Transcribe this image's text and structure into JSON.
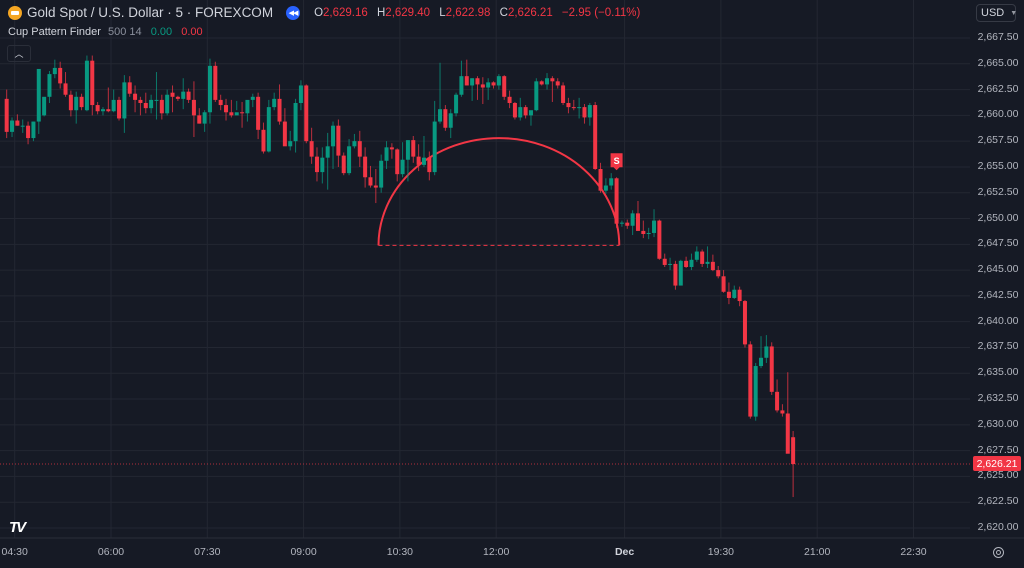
{
  "header": {
    "symbol_title": "Gold Spot / U.S. Dollar · 5 · FOREXCOM",
    "ohlc": [
      {
        "key": "O",
        "value": "2,629.16"
      },
      {
        "key": "H",
        "value": "2,629.40"
      },
      {
        "key": "L",
        "value": "2,622.98"
      },
      {
        "key": "C",
        "value": "2,626.21"
      }
    ],
    "change": "−2.95 (−0.11%)"
  },
  "indicator": {
    "name": "Cup Pattern Finder",
    "params": "500 14",
    "value1": "0.00",
    "value2": "0.00"
  },
  "currency_selector": "USD",
  "current_price_label": "2,626.21",
  "colors": {
    "up": "#089981",
    "down": "#f23645",
    "background": "#161a25",
    "grid": "#232732",
    "pattern": "#f23645"
  },
  "chart_data": {
    "type": "candlestick",
    "title": "Gold Spot / U.S. Dollar · 5 · FOREXCOM",
    "timeframe": "5",
    "y_ticks": [
      "2,667.50",
      "2,665.00",
      "2,662.50",
      "2,660.00",
      "2,657.50",
      "2,655.00",
      "2,652.50",
      "2,650.00",
      "2,647.50",
      "2,645.00",
      "2,642.50",
      "2,640.00",
      "2,637.50",
      "2,635.00",
      "2,632.50",
      "2,630.00",
      "2,627.50",
      "2,625.00",
      "2,622.50",
      "2,620.00"
    ],
    "ylim": [
      2618.8,
      2669.5
    ],
    "x_ticks": [
      {
        "label": "04:30",
        "bar": 2
      },
      {
        "label": "06:00",
        "bar": 20
      },
      {
        "label": "07:30",
        "bar": 38
      },
      {
        "label": "09:00",
        "bar": 56
      },
      {
        "label": "10:30",
        "bar": 74
      },
      {
        "label": "12:00",
        "bar": 92
      },
      {
        "label": "Dec",
        "bar": 116,
        "bold": true
      },
      {
        "label": "19:30",
        "bar": 134
      },
      {
        "label": "21:00",
        "bar": 152
      },
      {
        "label": "22:30",
        "bar": 170
      }
    ],
    "bar_count_visible": 186,
    "candles": [
      [
        2661.6,
        2662.5,
        2657.8,
        2658.4
      ],
      [
        2658.4,
        2659.8,
        2657.9,
        2659.5
      ],
      [
        2659.5,
        2660.1,
        2659.0,
        2659.0
      ],
      [
        2659.0,
        2659.6,
        2658.3,
        2659.0
      ],
      [
        2659.0,
        2659.4,
        2657.2,
        2657.8
      ],
      [
        2657.8,
        2659.4,
        2657.5,
        2659.4
      ],
      [
        2659.4,
        2660.6,
        2658.2,
        2664.5
      ],
      [
        2660.0,
        2660.6,
        2659.9,
        2661.8
      ],
      [
        2661.8,
        2664.3,
        2661.2,
        2664.0
      ],
      [
        2664.0,
        2665.4,
        2663.6,
        2664.6
      ],
      [
        2664.6,
        2665.2,
        2662.6,
        2663.1
      ],
      [
        2663.1,
        2664.2,
        2661.8,
        2662.0
      ],
      [
        2662.0,
        2662.4,
        2659.9,
        2660.5
      ],
      [
        2660.5,
        2662.3,
        2659.2,
        2661.8
      ],
      [
        2661.8,
        2662.1,
        2660.5,
        2660.8
      ],
      [
        2660.5,
        2665.8,
        2660.4,
        2665.3
      ],
      [
        2665.3,
        2665.8,
        2660.0,
        2661.0
      ],
      [
        2661.0,
        2661.3,
        2660.1,
        2660.4
      ],
      [
        2660.4,
        2660.8,
        2660.0,
        2660.6
      ],
      [
        2660.6,
        2662.7,
        2660.3,
        2660.4
      ],
      [
        2660.4,
        2662.5,
        2660.3,
        2661.5
      ],
      [
        2661.5,
        2661.8,
        2659.5,
        2659.7
      ],
      [
        2659.7,
        2663.9,
        2658.3,
        2663.2
      ],
      [
        2663.2,
        2663.8,
        2661.8,
        2662.1
      ],
      [
        2662.1,
        2662.9,
        2660.3,
        2661.5
      ],
      [
        2661.5,
        2661.8,
        2660.0,
        2661.2
      ],
      [
        2661.2,
        2662.2,
        2660.2,
        2660.7
      ],
      [
        2660.7,
        2662.0,
        2660.2,
        2661.5
      ],
      [
        2661.5,
        2664.2,
        2659.6,
        2661.5
      ],
      [
        2661.5,
        2662.0,
        2659.6,
        2660.2
      ],
      [
        2660.2,
        2662.5,
        2660.0,
        2662.0
      ],
      [
        2662.2,
        2662.9,
        2660.3,
        2661.8
      ],
      [
        2661.8,
        2661.9,
        2661.4,
        2661.6
      ],
      [
        2661.6,
        2663.6,
        2660.6,
        2662.3
      ],
      [
        2662.3,
        2662.6,
        2661.2,
        2661.5
      ],
      [
        2661.5,
        2663.3,
        2657.9,
        2660.0
      ],
      [
        2660.0,
        2660.7,
        2659.2,
        2659.2
      ],
      [
        2659.2,
        2660.5,
        2658.4,
        2660.3
      ],
      [
        2660.3,
        2665.5,
        2659.2,
        2664.8
      ],
      [
        2664.8,
        2665.2,
        2661.3,
        2661.5
      ],
      [
        2661.5,
        2662.0,
        2660.5,
        2661.0
      ],
      [
        2661.0,
        2661.6,
        2659.5,
        2660.3
      ],
      [
        2660.3,
        2661.5,
        2659.8,
        2660.0
      ],
      [
        2660.0,
        2661.4,
        2660.5,
        2660.3
      ],
      [
        2660.3,
        2661.3,
        2658.8,
        2660.2
      ],
      [
        2660.2,
        2661.0,
        2659.4,
        2661.5
      ],
      [
        2661.5,
        2662.1,
        2660.8,
        2661.8
      ],
      [
        2661.8,
        2662.2,
        2657.7,
        2658.6
      ],
      [
        2658.6,
        2659.3,
        2656.3,
        2656.5
      ],
      [
        2656.5,
        2661.5,
        2656.4,
        2660.8
      ],
      [
        2660.8,
        2662.2,
        2660.5,
        2661.6
      ],
      [
        2661.6,
        2663.0,
        2659.1,
        2659.4
      ],
      [
        2659.4,
        2660.7,
        2658.8,
        2657.0
      ],
      [
        2657.0,
        2658.5,
        2656.6,
        2657.5
      ],
      [
        2657.5,
        2661.6,
        2656.4,
        2661.2
      ],
      [
        2661.2,
        2663.4,
        2660.5,
        2662.9
      ],
      [
        2662.9,
        2663.0,
        2657.3,
        2657.5
      ],
      [
        2657.5,
        2658.8,
        2655.3,
        2656.0
      ],
      [
        2656.0,
        2656.9,
        2653.6,
        2654.5
      ],
      [
        2654.5,
        2656.9,
        2653.4,
        2655.9
      ],
      [
        2655.9,
        2658.3,
        2652.8,
        2657.0
      ],
      [
        2657.0,
        2659.4,
        2654.8,
        2659.0
      ],
      [
        2659.0,
        2659.6,
        2655.0,
        2656.1
      ],
      [
        2656.1,
        2656.4,
        2654.2,
        2654.4
      ],
      [
        2654.4,
        2657.7,
        2654.2,
        2657.0
      ],
      [
        2657.0,
        2658.2,
        2656.8,
        2657.5
      ],
      [
        2657.5,
        2658.5,
        2655.0,
        2656.0
      ],
      [
        2656.0,
        2656.9,
        2653.0,
        2654.0
      ],
      [
        2654.0,
        2655.1,
        2653.0,
        2653.2
      ],
      [
        2653.2,
        2654.8,
        2651.5,
        2653.0
      ],
      [
        2653.0,
        2656.2,
        2652.5,
        2655.6
      ],
      [
        2655.6,
        2657.5,
        2654.8,
        2656.9
      ],
      [
        2656.9,
        2657.3,
        2655.8,
        2656.7
      ],
      [
        2656.7,
        2656.8,
        2653.6,
        2654.3
      ],
      [
        2654.3,
        2657.4,
        2654.0,
        2655.7
      ],
      [
        2655.7,
        2657.6,
        2653.6,
        2657.6
      ],
      [
        2657.6,
        2658.0,
        2655.4,
        2656.0
      ],
      [
        2656.0,
        2657.2,
        2654.6,
        2655.2
      ],
      [
        2655.2,
        2658.0,
        2655.0,
        2655.9
      ],
      [
        2655.9,
        2656.5,
        2653.7,
        2654.5
      ],
      [
        2654.5,
        2661.4,
        2654.2,
        2659.4
      ],
      [
        2659.4,
        2665.1,
        2659.2,
        2660.6
      ],
      [
        2660.6,
        2661.0,
        2658.5,
        2658.8
      ],
      [
        2658.8,
        2660.6,
        2657.8,
        2660.2
      ],
      [
        2660.2,
        2662.2,
        2659.9,
        2662.0
      ],
      [
        2662.0,
        2665.3,
        2661.8,
        2663.8
      ],
      [
        2663.8,
        2665.4,
        2662.9,
        2662.9
      ],
      [
        2662.9,
        2663.6,
        2661.4,
        2663.6
      ],
      [
        2663.6,
        2663.8,
        2661.5,
        2663.0
      ],
      [
        2663.0,
        2663.7,
        2661.1,
        2662.7
      ],
      [
        2662.7,
        2663.6,
        2661.5,
        2663.2
      ],
      [
        2663.2,
        2663.3,
        2662.6,
        2662.9
      ],
      [
        2662.9,
        2664.0,
        2662.5,
        2663.8
      ],
      [
        2663.8,
        2663.9,
        2661.5,
        2661.8
      ],
      [
        2661.8,
        2662.4,
        2660.7,
        2661.2
      ],
      [
        2661.2,
        2661.3,
        2659.6,
        2659.8
      ],
      [
        2659.8,
        2661.7,
        2659.5,
        2660.8
      ],
      [
        2660.8,
        2661.0,
        2659.7,
        2660.0
      ],
      [
        2660.0,
        2660.2,
        2659.0,
        2660.5
      ],
      [
        2660.5,
        2663.6,
        2660.4,
        2663.3
      ],
      [
        2663.3,
        2663.4,
        2662.9,
        2663.0
      ],
      [
        2663.0,
        2664.1,
        2662.5,
        2663.6
      ],
      [
        2663.6,
        2663.8,
        2661.3,
        2663.3
      ],
      [
        2663.3,
        2663.6,
        2662.6,
        2662.9
      ],
      [
        2662.9,
        2663.2,
        2661.0,
        2661.2
      ],
      [
        2661.2,
        2661.7,
        2660.2,
        2660.8
      ],
      [
        2660.8,
        2661.5,
        2660.5,
        2660.7
      ],
      [
        2660.7,
        2661.7,
        2659.7,
        2660.8
      ],
      [
        2660.8,
        2661.1,
        2659.2,
        2659.8
      ],
      [
        2659.8,
        2661.2,
        2659.0,
        2661.0
      ],
      [
        2661.0,
        2661.3,
        2654.7,
        2654.8
      ],
      [
        2654.8,
        2655.4,
        2652.5,
        2652.7
      ],
      [
        2652.7,
        2653.9,
        2652.4,
        2653.2
      ],
      [
        2653.2,
        2654.4,
        2652.8,
        2653.9
      ],
      [
        2653.9,
        2654.0,
        2649.1,
        2649.5
      ],
      [
        2649.5,
        2649.8,
        2649.2,
        2649.6
      ],
      [
        2649.6,
        2649.9,
        2649.0,
        2649.3
      ],
      [
        2649.3,
        2650.8,
        2648.4,
        2650.5
      ],
      [
        2650.5,
        2651.7,
        2648.8,
        2648.8
      ],
      [
        2648.8,
        2649.8,
        2648.1,
        2648.5
      ],
      [
        2648.5,
        2649.1,
        2648.0,
        2648.6
      ],
      [
        2648.6,
        2650.9,
        2648.2,
        2649.8
      ],
      [
        2649.8,
        2649.9,
        2646.0,
        2646.1
      ],
      [
        2646.1,
        2646.6,
        2645.3,
        2645.5
      ],
      [
        2645.5,
        2646.2,
        2645.0,
        2645.6
      ],
      [
        2645.6,
        2645.9,
        2643.1,
        2643.5
      ],
      [
        2643.5,
        2646.0,
        2643.6,
        2645.9
      ],
      [
        2645.9,
        2646.3,
        2645.2,
        2645.3
      ],
      [
        2645.3,
        2646.6,
        2645.0,
        2646.0
      ],
      [
        2646.0,
        2647.3,
        2645.8,
        2646.8
      ],
      [
        2646.8,
        2647.0,
        2645.3,
        2645.6
      ],
      [
        2645.6,
        2647.3,
        2645.2,
        2645.8
      ],
      [
        2645.8,
        2646.5,
        2644.9,
        2645.0
      ],
      [
        2645.0,
        2645.4,
        2644.2,
        2644.4
      ],
      [
        2644.4,
        2645.0,
        2642.8,
        2642.9
      ],
      [
        2642.9,
        2643.8,
        2641.7,
        2642.3
      ],
      [
        2642.3,
        2643.5,
        2642.2,
        2643.1
      ],
      [
        2643.1,
        2643.4,
        2641.5,
        2642.0
      ],
      [
        2642.0,
        2642.1,
        2637.5,
        2637.8
      ],
      [
        2637.8,
        2638.1,
        2630.6,
        2630.8
      ],
      [
        2630.8,
        2636.0,
        2630.4,
        2635.7
      ],
      [
        2635.7,
        2638.6,
        2635.5,
        2636.5
      ],
      [
        2636.5,
        2638.7,
        2636.0,
        2637.6
      ],
      [
        2637.6,
        2638.0,
        2632.9,
        2633.2
      ],
      [
        2633.2,
        2634.4,
        2631.2,
        2631.4
      ],
      [
        2631.4,
        2632.0,
        2630.8,
        2631.1
      ],
      [
        2631.1,
        2635.1,
        2629.9,
        2627.2
      ],
      [
        2628.8,
        2629.4,
        2623.0,
        2626.2
      ]
    ],
    "cup_pattern": {
      "type": "Cup Pattern (inverted)",
      "start_bar": 70,
      "end_bar": 115,
      "base_price": 2647.4,
      "peak_price": 2657.8
    },
    "signal": {
      "label": "S",
      "bar": 114,
      "price": 2654.2
    },
    "last_price": 2626.21
  }
}
